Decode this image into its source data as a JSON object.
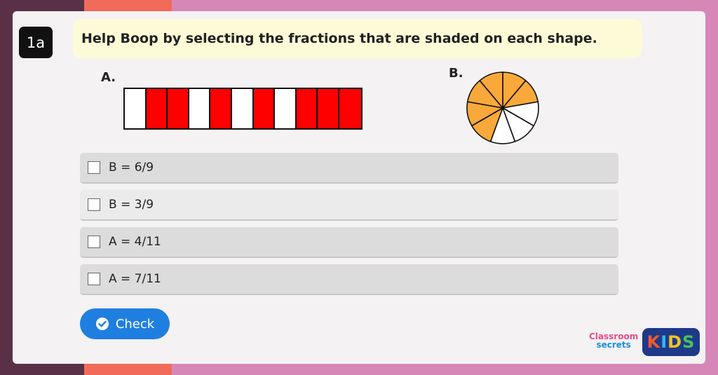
{
  "question": {
    "number": "1a",
    "text": "Help Boop by selecting the fractions that are shaded on each shape."
  },
  "shapes": {
    "a": {
      "label": "A.",
      "segments": [
        false,
        true,
        true,
        false,
        true,
        false,
        true,
        false,
        true,
        true,
        true
      ],
      "shade_color": "#ff0000"
    },
    "b": {
      "label": "B.",
      "sectors": [
        true,
        true,
        false,
        false,
        false,
        true,
        true,
        true,
        true
      ],
      "shade_color": "#f9a93a"
    }
  },
  "options": [
    {
      "label": "B = 6/9",
      "checked": false
    },
    {
      "label": "B = 3/9",
      "checked": false
    },
    {
      "label": "A = 4/11",
      "checked": false
    },
    {
      "label": "A = 7/11",
      "checked": false
    }
  ],
  "check_button": {
    "label": "Check"
  },
  "logo": {
    "line1": "Classroom",
    "line2": "secrets",
    "kids": [
      "K",
      "I",
      "D",
      "S"
    ]
  },
  "colors": {
    "accent": "#1f7fe0",
    "question_box": "#fdfbd7"
  }
}
